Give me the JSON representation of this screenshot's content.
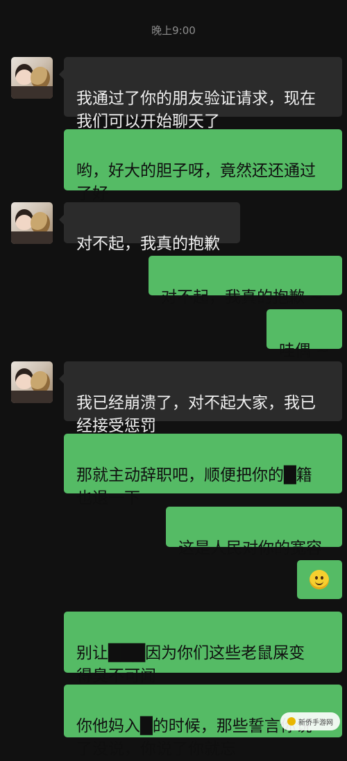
{
  "timestamp": "晚上9:00",
  "messages": [
    {
      "sender": "left",
      "text": "我通过了你的朋友验证请求，现在\n我们可以开始聊天了"
    },
    {
      "sender": "right",
      "text": "哟，好大的胆子呀，竟然还还通过\n了好"
    },
    {
      "sender": "left",
      "text": "对不起，我真的抱歉"
    },
    {
      "sender": "right",
      "text": "对不起，我真的抱歉 ~"
    },
    {
      "sender": "right",
      "text": "哇偶 ~"
    },
    {
      "sender": "left",
      "text": "我已经崩溃了，对不起大家，我已\n经接受惩罚"
    },
    {
      "sender": "right",
      "text": "那就主动辞职吧，顺便把你的█籍\n也退一下"
    },
    {
      "sender": "right",
      "text": "这是人民对你的宽容"
    },
    {
      "sender": "right",
      "emoji": "smile-emoji"
    },
    {
      "sender": "right",
      "text": "别让███因为你们这些老鼠屎变\n得臭不可闻"
    },
    {
      "sender": "right",
      "text": "你他妈入█的时候，那些誓言你说\n了没说，你说了你就忘"
    }
  ],
  "watermark": {
    "label": "新侨手游网",
    "icon": "game-logo-icon"
  },
  "colors": {
    "background": "#111111",
    "sent_bubble": "#55bb65",
    "received_bubble": "#2b2b2b"
  }
}
